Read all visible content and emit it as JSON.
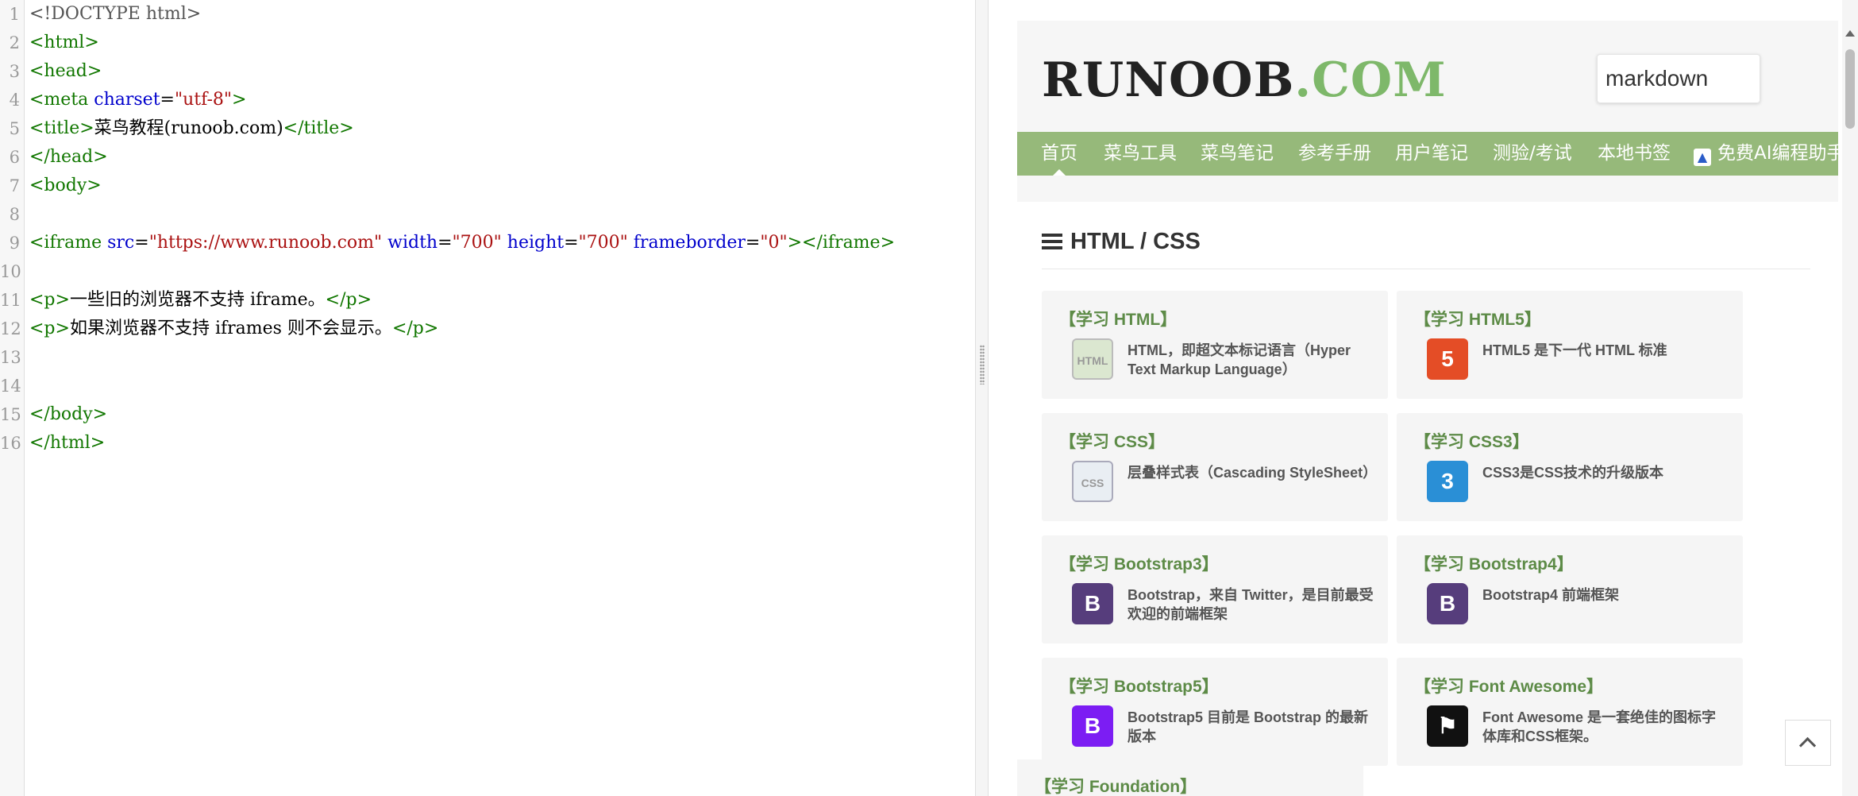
{
  "editor": {
    "lines": [
      {
        "num": "1",
        "parts": [
          {
            "t": "<!DOCTYPE html>",
            "c": "dt"
          }
        ]
      },
      {
        "num": "2",
        "parts": [
          {
            "t": "<html>",
            "c": "tg"
          }
        ]
      },
      {
        "num": "3",
        "parts": [
          {
            "t": "<head>",
            "c": "tg"
          }
        ]
      },
      {
        "num": "4",
        "parts": [
          {
            "t": "<meta ",
            "c": "tg"
          },
          {
            "t": "charset",
            "c": "at"
          },
          {
            "t": "=",
            "c": ""
          },
          {
            "t": "\"utf-8\"",
            "c": "st"
          },
          {
            "t": ">",
            "c": "tg"
          }
        ]
      },
      {
        "num": "5",
        "parts": [
          {
            "t": "<title>",
            "c": "tg"
          },
          {
            "t": "菜鸟教程(runoob.com)",
            "c": ""
          },
          {
            "t": "</title>",
            "c": "tg"
          }
        ]
      },
      {
        "num": "6",
        "parts": [
          {
            "t": "</head>",
            "c": "tg"
          }
        ]
      },
      {
        "num": "7",
        "parts": [
          {
            "t": "<body>",
            "c": "tg"
          }
        ]
      },
      {
        "num": "8",
        "parts": []
      },
      {
        "num": "9",
        "parts": [
          {
            "t": "<iframe ",
            "c": "tg"
          },
          {
            "t": "src",
            "c": "at"
          },
          {
            "t": "=",
            "c": ""
          },
          {
            "t": "\"https://www.runoob.com\"",
            "c": "st"
          },
          {
            "t": " ",
            "c": ""
          },
          {
            "t": "width",
            "c": "at"
          },
          {
            "t": "=",
            "c": ""
          },
          {
            "t": "\"700\"",
            "c": "st"
          },
          {
            "t": " ",
            "c": ""
          },
          {
            "t": "height",
            "c": "at"
          },
          {
            "t": "=",
            "c": ""
          },
          {
            "t": "\"700\"",
            "c": "st"
          },
          {
            "t": " ",
            "c": ""
          },
          {
            "t": "frameborder",
            "c": "at"
          },
          {
            "t": "=",
            "c": ""
          },
          {
            "t": "\"0\"",
            "c": "st"
          },
          {
            "t": "></iframe>",
            "c": "tg"
          }
        ]
      },
      {
        "num": "10",
        "parts": []
      },
      {
        "num": "11",
        "parts": [
          {
            "t": "<p>",
            "c": "tg"
          },
          {
            "t": "一些旧的浏览器不支持 iframe。",
            "c": ""
          },
          {
            "t": "</p>",
            "c": "tg"
          }
        ]
      },
      {
        "num": "12",
        "parts": [
          {
            "t": "<p>",
            "c": "tg"
          },
          {
            "t": "如果浏览器不支持 iframes 则不会显示。",
            "c": ""
          },
          {
            "t": "</p>",
            "c": "tg"
          }
        ]
      },
      {
        "num": "13",
        "parts": []
      },
      {
        "num": "14",
        "parts": []
      },
      {
        "num": "15",
        "parts": [
          {
            "t": "</body>",
            "c": "tg"
          }
        ]
      },
      {
        "num": "16",
        "parts": [
          {
            "t": "</html>",
            "c": "tg"
          }
        ]
      }
    ]
  },
  "preview": {
    "logo": {
      "main": "RUNOOB",
      "tld": ".COM"
    },
    "search": {
      "value": "markdown"
    },
    "nav": [
      {
        "label": "首页",
        "active": true
      },
      {
        "label": "菜鸟工具"
      },
      {
        "label": "菜鸟笔记"
      },
      {
        "label": "参考手册"
      },
      {
        "label": "用户笔记"
      },
      {
        "label": "测验/考试"
      },
      {
        "label": "本地书签"
      },
      {
        "label": "免费AI编程助手",
        "icon": "ai-logo-icon"
      }
    ],
    "section_title": "HTML / CSS",
    "cards": [
      {
        "title": "【学习 HTML】",
        "desc": "HTML，即超文本标记语言（Hyper Text Markup Language）",
        "icon": "html-icon",
        "icon_text": "HTML",
        "cls": "ic-html"
      },
      {
        "title": "【学习 HTML5】",
        "desc": "HTML5 是下一代 HTML 标准",
        "icon": "html5-icon",
        "icon_text": "5",
        "cls": "ic-html5"
      },
      {
        "title": "【学习 CSS】",
        "desc": "层叠样式表（Cascading StyleSheet）",
        "icon": "css-icon",
        "icon_text": "CSS",
        "cls": "ic-css"
      },
      {
        "title": "【学习 CSS3】",
        "desc": "CSS3是CSS技术的升级版本",
        "icon": "css3-icon",
        "icon_text": "3",
        "cls": "ic-css3"
      },
      {
        "title": "【学习 Bootstrap3】",
        "desc": "Bootstrap，来自 Twitter，是目前最受欢迎的前端框架",
        "icon": "bootstrap3-icon",
        "icon_text": "B",
        "cls": "ic-bs3"
      },
      {
        "title": "【学习 Bootstrap4】",
        "desc": "Bootstrap4 前端框架",
        "icon": "bootstrap4-icon",
        "icon_text": "B",
        "cls": "ic-bs4"
      },
      {
        "title": "【学习 Bootstrap5】",
        "desc": "Bootstrap5 目前是 Bootstrap 的最新版本",
        "icon": "bootstrap5-icon",
        "icon_text": "B",
        "cls": "ic-bs5"
      },
      {
        "title": "【学习 Font Awesome】",
        "desc": "Font Awesome 是一套绝佳的图标字体库和CSS框架。",
        "icon": "font-awesome-flag-icon",
        "icon_text": "⚑",
        "cls": "ic-fa"
      }
    ],
    "partial_card_title": "【学习 Foundation】",
    "colors": {
      "nav_bg": "#96b97a",
      "accent_green": "#5d8b47",
      "logo_dot": "#7eb86a"
    }
  }
}
